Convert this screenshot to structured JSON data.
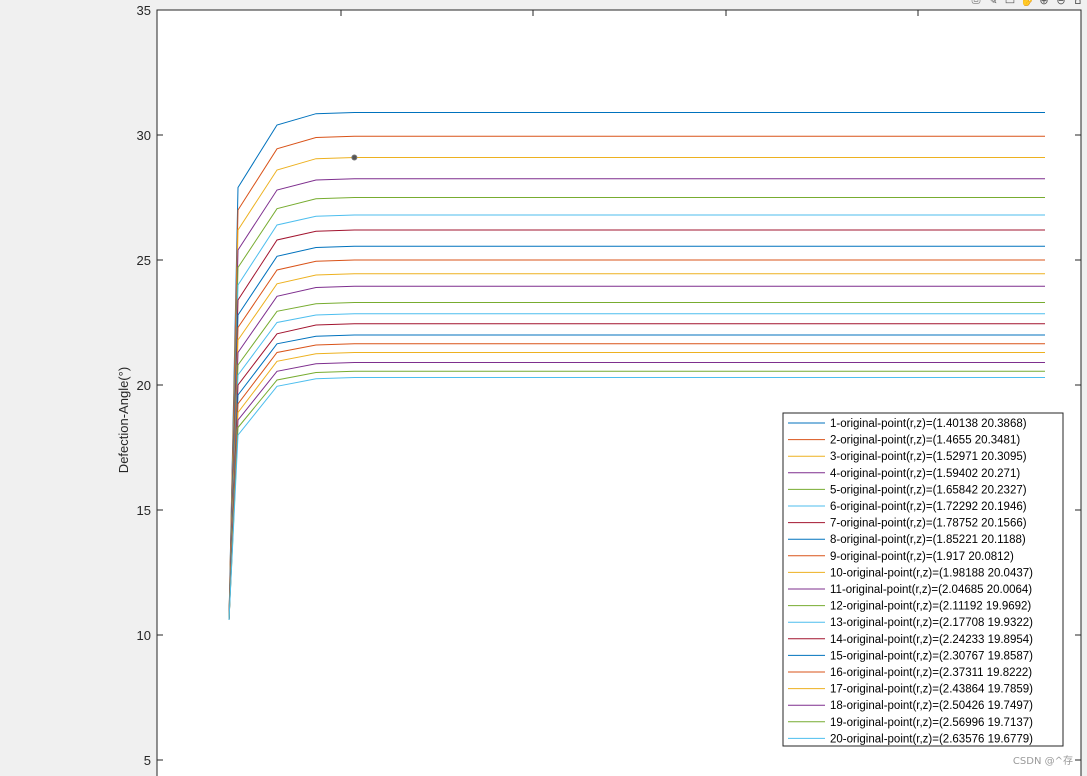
{
  "toolbar": {
    "icons": [
      "export-icon",
      "brush-icon",
      "rotate-icon",
      "pan-icon",
      "zoom-in-icon",
      "zoom-out-icon",
      "home-icon"
    ],
    "glyphs": [
      "⎙",
      "✎",
      "▭",
      "✋",
      "⊕",
      "⊖",
      "⌂"
    ]
  },
  "watermark": "CSDN @^存",
  "chart_data": {
    "type": "line",
    "title": "",
    "xlabel": "",
    "ylabel": "Defection-Angle(°)",
    "ylim": [
      3.5,
      35
    ],
    "yticks": [
      5,
      10,
      15,
      20,
      25,
      30,
      35
    ],
    "grid": false,
    "legend_position": "right",
    "start_value": 10.6,
    "x": [
      0,
      1,
      2,
      3,
      4,
      5,
      6,
      7,
      8,
      9,
      10,
      11,
      12,
      13,
      14,
      15,
      16,
      17,
      18,
      19,
      20,
      21,
      22
    ],
    "colors": [
      "#0072BD",
      "#D95319",
      "#EDB120",
      "#7E2F8E",
      "#77AC30",
      "#4DBEEE",
      "#A2142F"
    ],
    "series": [
      {
        "name": "1-original-point(r,z)=(1.40138        20.3868)",
        "values": [
          10.6,
          27.9,
          30.4,
          30.85,
          30.9,
          30.9,
          30.9,
          30.9,
          30.9,
          30.9,
          30.9,
          30.9,
          30.9,
          30.9,
          30.9,
          30.9,
          30.9,
          30.9,
          30.9,
          30.9,
          30.9,
          30.9,
          30.9
        ]
      },
      {
        "name": "2-original-point(r,z)=(1.4655        20.3481)",
        "values": [
          10.6,
          27.0,
          29.45,
          29.9,
          29.95,
          29.95,
          29.95,
          29.95,
          29.95,
          29.95,
          29.95,
          29.95,
          29.95,
          29.95,
          29.95,
          29.95,
          29.95,
          29.95,
          29.95,
          29.95,
          29.95,
          29.95,
          29.95
        ]
      },
      {
        "name": "3-original-point(r,z)=(1.52971        20.3095)",
        "values": [
          10.6,
          26.2,
          28.6,
          29.05,
          29.1,
          29.1,
          29.1,
          29.1,
          29.1,
          29.1,
          29.1,
          29.1,
          29.1,
          29.1,
          29.1,
          29.1,
          29.1,
          29.1,
          29.1,
          29.1,
          29.1,
          29.1,
          29.1
        ]
      },
      {
        "name": "4-original-point(r,z)=(1.59402        20.271)",
        "values": [
          10.6,
          25.4,
          27.8,
          28.2,
          28.25,
          28.25,
          28.25,
          28.25,
          28.25,
          28.25,
          28.25,
          28.25,
          28.25,
          28.25,
          28.25,
          28.25,
          28.25,
          28.25,
          28.25,
          28.25,
          28.25,
          28.25,
          28.25
        ]
      },
      {
        "name": "5-original-point(r,z)=(1.65842        20.2327)",
        "values": [
          10.6,
          24.7,
          27.05,
          27.45,
          27.5,
          27.5,
          27.5,
          27.5,
          27.5,
          27.5,
          27.5,
          27.5,
          27.5,
          27.5,
          27.5,
          27.5,
          27.5,
          27.5,
          27.5,
          27.5,
          27.5,
          27.5,
          27.5
        ]
      },
      {
        "name": "6-original-point(r,z)=(1.72292        20.1946)",
        "values": [
          10.6,
          24.0,
          26.4,
          26.75,
          26.8,
          26.8,
          26.8,
          26.8,
          26.8,
          26.8,
          26.8,
          26.8,
          26.8,
          26.8,
          26.8,
          26.8,
          26.8,
          26.8,
          26.8,
          26.8,
          26.8,
          26.8,
          26.8
        ]
      },
      {
        "name": "7-original-point(r,z)=(1.78752        20.1566)",
        "values": [
          10.6,
          23.4,
          25.8,
          26.15,
          26.2,
          26.2,
          26.2,
          26.2,
          26.2,
          26.2,
          26.2,
          26.2,
          26.2,
          26.2,
          26.2,
          26.2,
          26.2,
          26.2,
          26.2,
          26.2,
          26.2,
          26.2,
          26.2
        ]
      },
      {
        "name": "8-original-point(r,z)=(1.85221        20.1188)",
        "values": [
          10.6,
          22.8,
          25.15,
          25.5,
          25.55,
          25.55,
          25.55,
          25.55,
          25.55,
          25.55,
          25.55,
          25.55,
          25.55,
          25.55,
          25.55,
          25.55,
          25.55,
          25.55,
          25.55,
          25.55,
          25.55,
          25.55,
          25.55
        ]
      },
      {
        "name": "9-original-point(r,z)=(1.917        20.0812)",
        "values": [
          10.6,
          22.3,
          24.6,
          24.95,
          25.0,
          25.0,
          25.0,
          25.0,
          25.0,
          25.0,
          25.0,
          25.0,
          25.0,
          25.0,
          25.0,
          25.0,
          25.0,
          25.0,
          25.0,
          25.0,
          25.0,
          25.0,
          25.0
        ]
      },
      {
        "name": "10-original-point(r,z)=(1.98188        20.0437)",
        "values": [
          10.6,
          21.8,
          24.05,
          24.4,
          24.45,
          24.45,
          24.45,
          24.45,
          24.45,
          24.45,
          24.45,
          24.45,
          24.45,
          24.45,
          24.45,
          24.45,
          24.45,
          24.45,
          24.45,
          24.45,
          24.45,
          24.45,
          24.45
        ]
      },
      {
        "name": "11-original-point(r,z)=(2.04685        20.0064)",
        "values": [
          10.6,
          21.3,
          23.55,
          23.9,
          23.95,
          23.95,
          23.95,
          23.95,
          23.95,
          23.95,
          23.95,
          23.95,
          23.95,
          23.95,
          23.95,
          23.95,
          23.95,
          23.95,
          23.95,
          23.95,
          23.95,
          23.95,
          23.95
        ]
      },
      {
        "name": "12-original-point(r,z)=(2.11192        19.9692)",
        "values": [
          10.6,
          20.8,
          22.95,
          23.25,
          23.3,
          23.3,
          23.3,
          23.3,
          23.3,
          23.3,
          23.3,
          23.3,
          23.3,
          23.3,
          23.3,
          23.3,
          23.3,
          23.3,
          23.3,
          23.3,
          23.3,
          23.3,
          23.3
        ]
      },
      {
        "name": "13-original-point(r,z)=(2.17708        19.9322)",
        "values": [
          10.6,
          20.4,
          22.5,
          22.8,
          22.85,
          22.85,
          22.85,
          22.85,
          22.85,
          22.85,
          22.85,
          22.85,
          22.85,
          22.85,
          22.85,
          22.85,
          22.85,
          22.85,
          22.85,
          22.85,
          22.85,
          22.85,
          22.85
        ]
      },
      {
        "name": "14-original-point(r,z)=(2.24233        19.8954)",
        "values": [
          10.6,
          20.0,
          22.05,
          22.4,
          22.45,
          22.45,
          22.45,
          22.45,
          22.45,
          22.45,
          22.45,
          22.45,
          22.45,
          22.45,
          22.45,
          22.45,
          22.45,
          22.45,
          22.45,
          22.45,
          22.45,
          22.45,
          22.45
        ]
      },
      {
        "name": "15-original-point(r,z)=(2.30767        19.8587)",
        "values": [
          10.6,
          19.6,
          21.65,
          21.95,
          22.0,
          22.0,
          22.0,
          22.0,
          22.0,
          22.0,
          22.0,
          22.0,
          22.0,
          22.0,
          22.0,
          22.0,
          22.0,
          22.0,
          22.0,
          22.0,
          22.0,
          22.0,
          22.0
        ]
      },
      {
        "name": "16-original-point(r,z)=(2.37311        19.8222)",
        "values": [
          10.6,
          19.25,
          21.3,
          21.6,
          21.65,
          21.65,
          21.65,
          21.65,
          21.65,
          21.65,
          21.65,
          21.65,
          21.65,
          21.65,
          21.65,
          21.65,
          21.65,
          21.65,
          21.65,
          21.65,
          21.65,
          21.65,
          21.65
        ]
      },
      {
        "name": "17-original-point(r,z)=(2.43864        19.7859)",
        "values": [
          10.6,
          18.9,
          20.95,
          21.25,
          21.3,
          21.3,
          21.3,
          21.3,
          21.3,
          21.3,
          21.3,
          21.3,
          21.3,
          21.3,
          21.3,
          21.3,
          21.3,
          21.3,
          21.3,
          21.3,
          21.3,
          21.3,
          21.3
        ]
      },
      {
        "name": "18-original-point(r,z)=(2.50426        19.7497)",
        "values": [
          10.6,
          18.6,
          20.55,
          20.85,
          20.9,
          20.9,
          20.9,
          20.9,
          20.9,
          20.9,
          20.9,
          20.9,
          20.9,
          20.9,
          20.9,
          20.9,
          20.9,
          20.9,
          20.9,
          20.9,
          20.9,
          20.9,
          20.9
        ]
      },
      {
        "name": "19-original-point(r,z)=(2.56996        19.7137)",
        "values": [
          10.6,
          18.3,
          20.2,
          20.5,
          20.55,
          20.55,
          20.55,
          20.55,
          20.55,
          20.55,
          20.55,
          20.55,
          20.55,
          20.55,
          20.55,
          20.55,
          20.55,
          20.55,
          20.55,
          20.55,
          20.55,
          20.55,
          20.55
        ]
      },
      {
        "name": "20-original-point(r,z)=(2.63576        19.6779)",
        "values": [
          10.6,
          18.0,
          19.95,
          20.25,
          20.3,
          20.3,
          20.3,
          20.3,
          20.3,
          20.3,
          20.3,
          20.3,
          20.3,
          20.3,
          20.3,
          20.3,
          20.3,
          20.3,
          20.3,
          20.3,
          20.3,
          20.3,
          20.3
        ]
      }
    ],
    "marker_point": {
      "series_index": 2,
      "x": 4,
      "y": 29.1
    }
  }
}
